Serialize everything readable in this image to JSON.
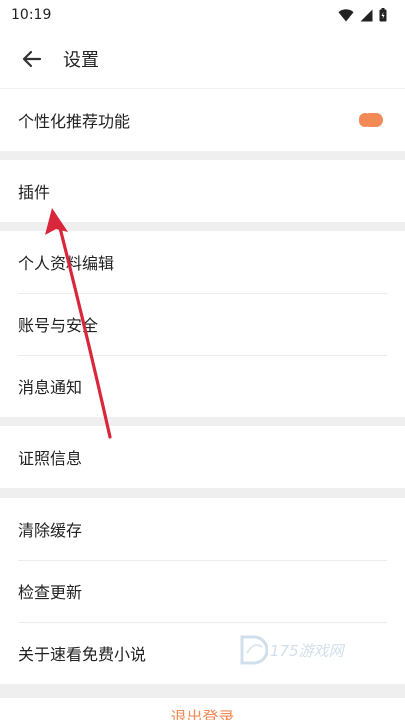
{
  "status_bar": {
    "time": "10:19"
  },
  "app_bar": {
    "title": "设置"
  },
  "groups": {
    "personalization": {
      "recommend_label": "个性化推荐功能",
      "recommend_enabled": true
    },
    "plugins": {
      "plugins_label": "插件"
    },
    "account": {
      "profile_label": "个人资料编辑",
      "security_label": "账号与安全",
      "notify_label": "消息通知"
    },
    "license": {
      "license_label": "证照信息"
    },
    "misc": {
      "cache_label": "清除缓存",
      "update_label": "检查更新",
      "about_label": "关于速看免费小说"
    }
  },
  "logout_label": "退出登录",
  "watermark": {
    "text": "175游戏网"
  },
  "colors": {
    "accent": "#f28a55",
    "arrow": "#d9263a",
    "separator": "#efefef"
  },
  "icons": [
    "back-arrow-icon",
    "wifi-icon",
    "signal-icon",
    "battery-icon",
    "annotation-arrow"
  ]
}
